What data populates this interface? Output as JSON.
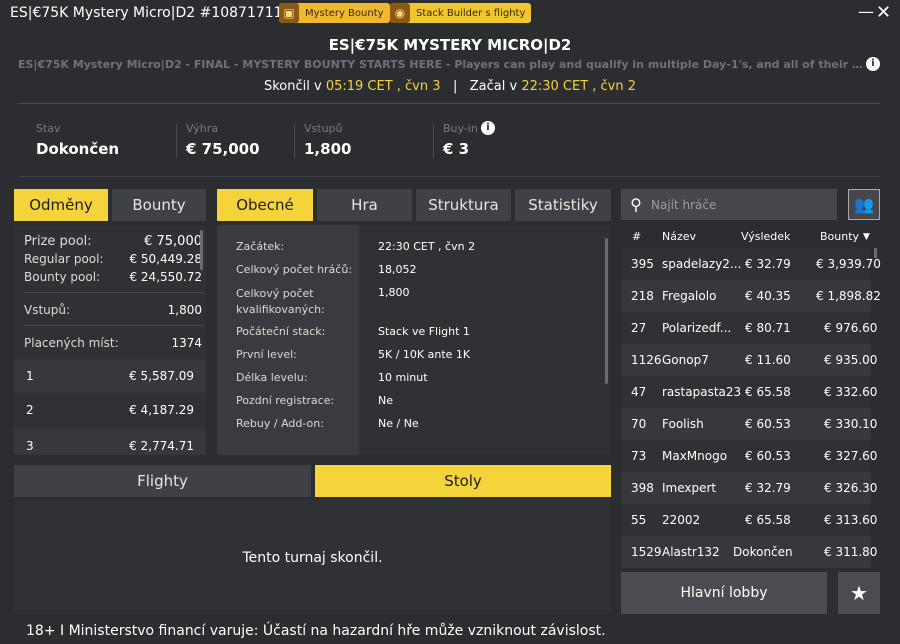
{
  "window": {
    "title": "ES|€75K Mystery Micro|D2 #1087171117",
    "badge_mystery": "Mystery Bounty",
    "badge_stack": "Stack Builder s flighty",
    "minimize": "—",
    "close": "✕"
  },
  "header": {
    "title": "ES|€75K MYSTERY MICRO|D2",
    "subtitle": "ES|€75K Mystery Micro|D2 - FINAL - MYSTERY BOUNTY STARTS HERE - Players can play and qualify in multiple Day-1's, and all of their qualifying stacks an...",
    "ended_label": "Skončil v",
    "ended_value": "05:19 CET , čvn 3",
    "divider": "|",
    "started_label": "Začal v",
    "started_value": "22:30 CET , čvn 2"
  },
  "stats": [
    {
      "label": "Stav",
      "value": "Dokončen"
    },
    {
      "label": "Výhra",
      "value": "€ 75,000"
    },
    {
      "label": "Vstupů",
      "value": "1,800"
    },
    {
      "label": "Buy-in",
      "value": "€ 3"
    }
  ],
  "left_tabs": {
    "rewards": "Odměny",
    "bounty": "Bounty"
  },
  "center_tabs": {
    "general": "Obecné",
    "game": "Hra",
    "structure": "Struktura",
    "statistics": "Statistiky"
  },
  "prize": {
    "prize_pool_label": "Prize pool:",
    "prize_pool": "€ 75,000",
    "regular_label": "Regular pool:",
    "regular": "€ 50,449.28",
    "bounty_label": "Bounty pool:",
    "bounty": "€ 24,550.72",
    "entries_label": "Vstupů:",
    "entries": "1,800",
    "paid_label": "Placených míst:",
    "paid": "1374",
    "places": [
      {
        "place": "1",
        "amount": "€ 5,587.09"
      },
      {
        "place": "2",
        "amount": "€ 4,187.29"
      },
      {
        "place": "3",
        "amount": "€ 2,774.71"
      }
    ]
  },
  "general": [
    {
      "label": "Začátek:",
      "value": "22:30 CET , čvn 2"
    },
    {
      "label": "Celkový počet hráčů:",
      "value": "18,052"
    },
    {
      "label": "Celkový počet kvalifikovaných:",
      "value": "1,800"
    },
    {
      "label": "Počáteční stack:",
      "value": "Stack ve Flight 1"
    },
    {
      "label": "První level:",
      "value": "5K / 10K ante 1K"
    },
    {
      "label": "Délka levelu:",
      "value": "10 minut"
    },
    {
      "label": "Pozdní registrace:",
      "value": "Ne"
    },
    {
      "label": "Rebuy / Add-on:",
      "value": "Ne / Ne"
    }
  ],
  "bottom_tabs": {
    "flights": "Flighty",
    "tables": "Stoly"
  },
  "ended_message": "Tento turnaj skončil.",
  "search": {
    "placeholder": "Najít hráče"
  },
  "players_head": {
    "rank": "#",
    "name": "Název",
    "result": "Výsledek",
    "bounty": "Bounty",
    "sort": "▼"
  },
  "players": [
    {
      "rank": "395",
      "name": "spadelazy2...",
      "result": "€ 32.79",
      "bounty": "€ 3,939.70"
    },
    {
      "rank": "218",
      "name": "Fregalolo",
      "result": "€ 40.35",
      "bounty": "€ 1,898.82"
    },
    {
      "rank": "27",
      "name": "Polarizedf...",
      "result": "€ 80.71",
      "bounty": "€ 976.60"
    },
    {
      "rank": "1126",
      "name": "Gonop7",
      "result": "€ 11.60",
      "bounty": "€ 935.00"
    },
    {
      "rank": "47",
      "name": "rastapasta23",
      "result": "€ 65.58",
      "bounty": "€ 332.60"
    },
    {
      "rank": "70",
      "name": "Foolish",
      "result": "€ 60.53",
      "bounty": "€ 330.10"
    },
    {
      "rank": "73",
      "name": "MaxMnogo",
      "result": "€ 60.53",
      "bounty": "€ 327.60"
    },
    {
      "rank": "398",
      "name": "Imexpert",
      "result": "€ 32.79",
      "bounty": "€ 326.30"
    },
    {
      "rank": "55",
      "name": "22002",
      "result": "€ 65.58",
      "bounty": "€ 313.60"
    },
    {
      "rank": "1529",
      "name": "Alastr132",
      "result": "Dokončen",
      "bounty": "€ 311.80"
    }
  ],
  "lobby_button": "Hlavní lobby",
  "footer": "18+ I Ministerstvo financí varuje: Účastí na hazardní hře může vzniknout závislost."
}
